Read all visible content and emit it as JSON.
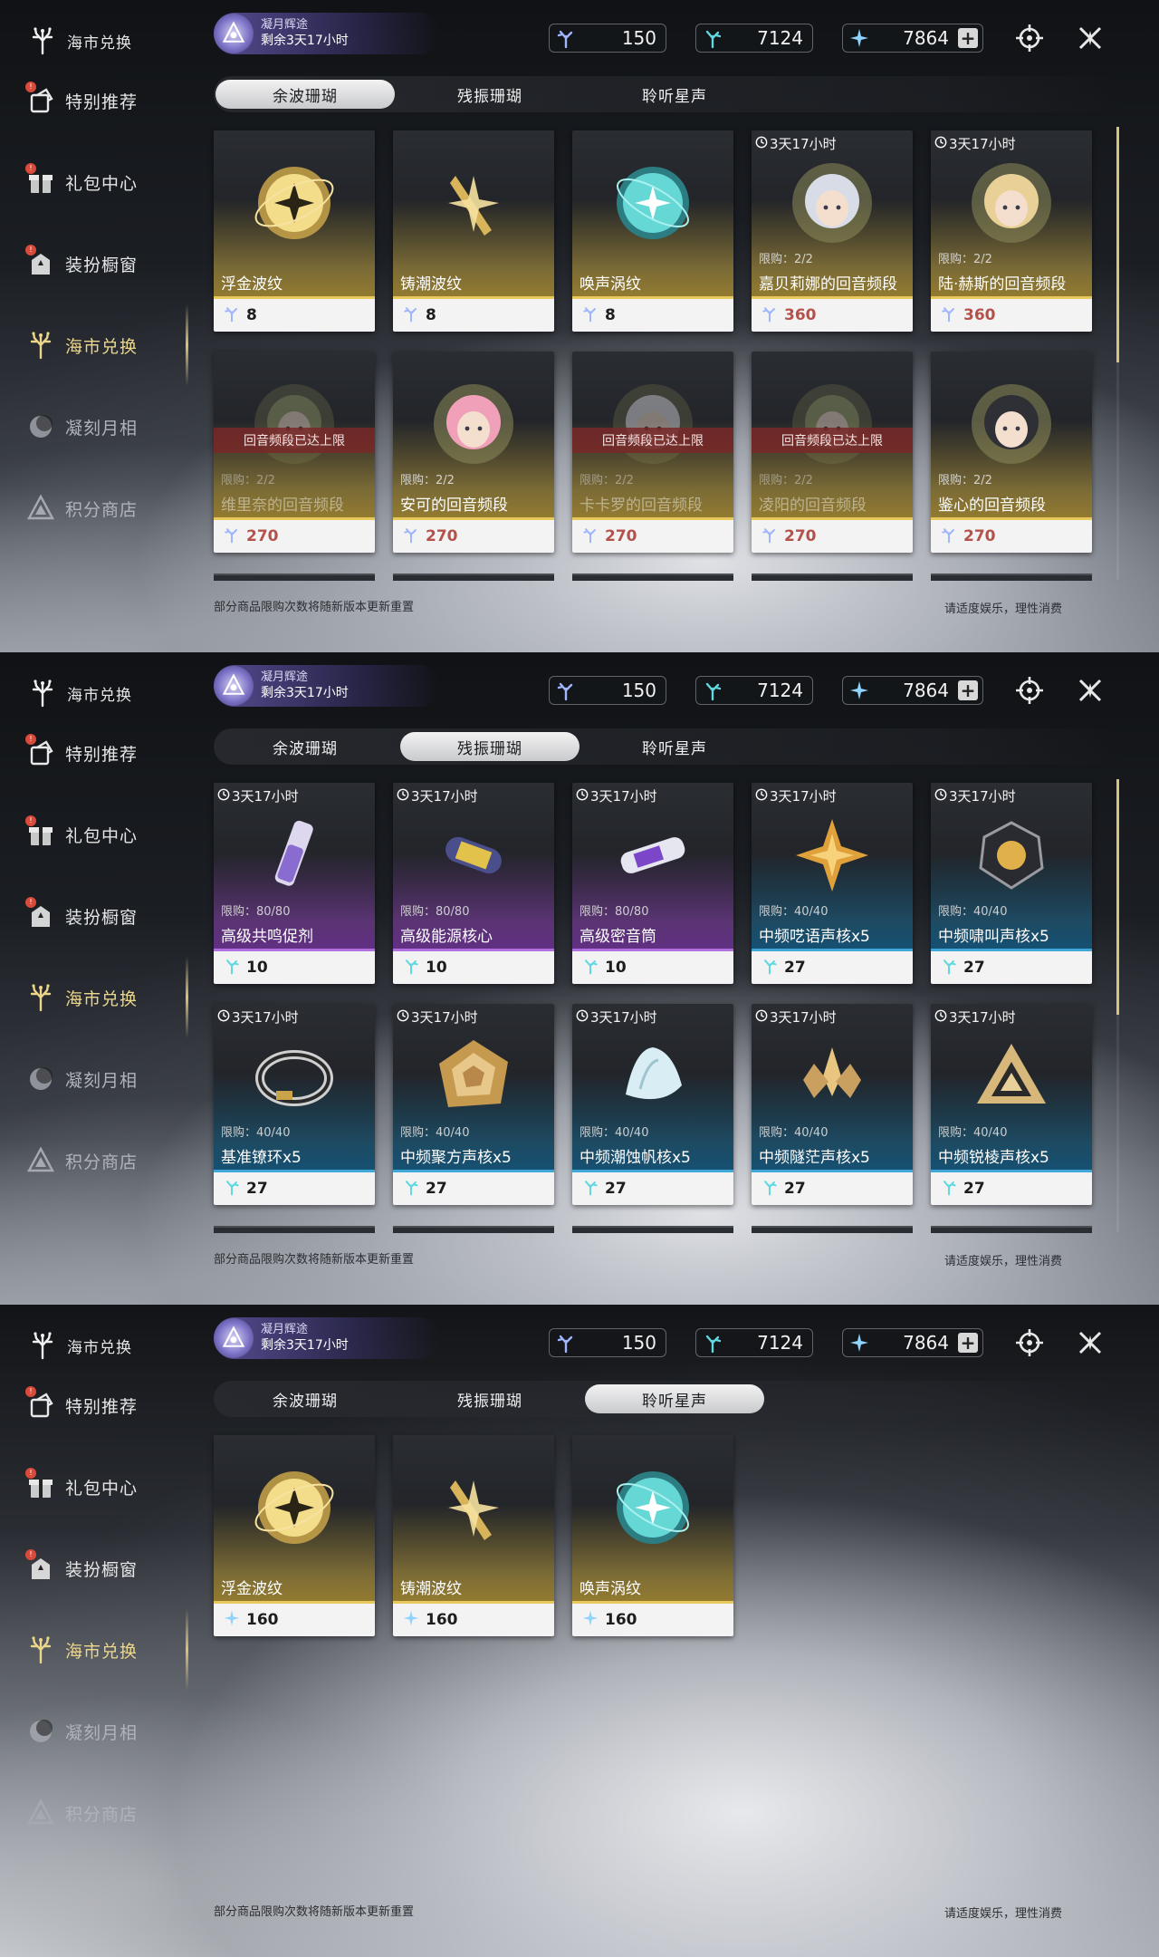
{
  "sidebar_header": "海市兑换",
  "sidebar": [
    {
      "label": "特别推荐",
      "icon": "recommend-icon",
      "badge": "!"
    },
    {
      "label": "礼包中心",
      "icon": "gift-icon",
      "badge": "!"
    },
    {
      "label": "装扮橱窗",
      "icon": "wardrobe-icon",
      "badge": "!"
    },
    {
      "label": "海市兑换",
      "icon": "coral-icon",
      "badge": ""
    },
    {
      "label": "凝刻月相",
      "icon": "moon-icon",
      "badge": ""
    },
    {
      "label": "积分商店",
      "icon": "points-shop-icon",
      "badge": ""
    }
  ],
  "event": {
    "title": "凝月辉途",
    "time": "剩余3天17小时"
  },
  "currencies": [
    {
      "icon": "afterglow-coral-icon",
      "value": "150"
    },
    {
      "icon": "oscillated-coral-icon",
      "value": "7124"
    },
    {
      "icon": "star-shard-icon",
      "value": "7864",
      "plus": "+"
    }
  ],
  "tabs": [
    "余波珊瑚",
    "残振珊瑚",
    "聆听星声"
  ],
  "footer": {
    "left": "部分商品限购次数将随新版本更新重置",
    "right": "请适度娱乐，理性消费"
  },
  "screens": [
    {
      "active_tab": 0,
      "cards": [
        {
          "tier": "gold",
          "timer": "",
          "limit": "",
          "name": "浮金波纹",
          "price": "8",
          "art": "gold-orb",
          "maxed": "",
          "warn": false
        },
        {
          "tier": "gold",
          "timer": "",
          "limit": "",
          "name": "铸潮波纹",
          "price": "8",
          "art": "gold-blade",
          "maxed": "",
          "warn": false
        },
        {
          "tier": "gold",
          "timer": "",
          "limit": "",
          "name": "唤声涡纹",
          "price": "8",
          "art": "teal-orb",
          "maxed": "",
          "warn": false
        },
        {
          "tier": "gold",
          "timer": "3天17小时",
          "limit": "限购：2/2",
          "name": "嘉贝莉娜的回音频段",
          "price": "360",
          "art": "portrait-silver",
          "maxed": "",
          "warn": true
        },
        {
          "tier": "gold",
          "timer": "3天17小时",
          "limit": "限购：2/2",
          "name": "陆·赫斯的回音频段",
          "price": "360",
          "art": "portrait-blond",
          "maxed": "",
          "warn": true
        },
        {
          "tier": "gold",
          "timer": "",
          "limit": "限购：2/2",
          "name": "维里奈的回音频段",
          "price": "270",
          "art": "portrait-green",
          "maxed": "回音频段已达上限",
          "warn": true
        },
        {
          "tier": "gold",
          "timer": "",
          "limit": "限购：2/2",
          "name": "安可的回音频段",
          "price": "270",
          "art": "portrait-pink",
          "maxed": "",
          "warn": true
        },
        {
          "tier": "gold",
          "timer": "",
          "limit": "限购：2/2",
          "name": "卡卡罗的回音频段",
          "price": "270",
          "art": "portrait-white",
          "maxed": "回音频段已达上限",
          "warn": true
        },
        {
          "tier": "gold",
          "timer": "",
          "limit": "限购：2/2",
          "name": "凌阳的回音频段",
          "price": "270",
          "art": "portrait-green",
          "maxed": "回音频段已达上限",
          "warn": true
        },
        {
          "tier": "gold",
          "timer": "",
          "limit": "限购：2/2",
          "name": "鉴心的回音频段",
          "price": "270",
          "art": "portrait-dark",
          "maxed": "",
          "warn": true
        }
      ]
    },
    {
      "active_tab": 1,
      "cards": [
        {
          "tier": "purple",
          "timer": "3天17小时",
          "limit": "限购：80/80",
          "name": "高级共鸣促剂",
          "price": "10",
          "art": "vial",
          "maxed": "",
          "warn": false
        },
        {
          "tier": "purple",
          "timer": "3天17小时",
          "limit": "限购：80/80",
          "name": "高级能源核心",
          "price": "10",
          "art": "capsule",
          "maxed": "",
          "warn": false
        },
        {
          "tier": "purple",
          "timer": "3天17小时",
          "limit": "限购：80/80",
          "name": "高级密音筒",
          "price": "10",
          "art": "cylinder",
          "maxed": "",
          "warn": false
        },
        {
          "tier": "blue",
          "timer": "3天17小时",
          "limit": "限购：40/40",
          "name": "中频呓语声核x5",
          "price": "27",
          "art": "star-core",
          "maxed": "",
          "warn": false
        },
        {
          "tier": "blue",
          "timer": "3天17小时",
          "limit": "限购：40/40",
          "name": "中频啸叫声核x5",
          "price": "27",
          "art": "dark-core",
          "maxed": "",
          "warn": false
        },
        {
          "tier": "blue",
          "timer": "3天17小时",
          "limit": "限购：40/40",
          "name": "基准镣环x5",
          "price": "27",
          "art": "ring",
          "maxed": "",
          "warn": false
        },
        {
          "tier": "blue",
          "timer": "3天17小时",
          "limit": "限购：40/40",
          "name": "中频聚方声核x5",
          "price": "27",
          "art": "layered-core",
          "maxed": "",
          "warn": false
        },
        {
          "tier": "blue",
          "timer": "3天17小时",
          "limit": "限购：40/40",
          "name": "中频潮蚀帆核x5",
          "price": "27",
          "art": "shell",
          "maxed": "",
          "warn": false
        },
        {
          "tier": "blue",
          "timer": "3天17小时",
          "limit": "限购：40/40",
          "name": "中频隧茫声核x5",
          "price": "27",
          "art": "crystal",
          "maxed": "",
          "warn": false
        },
        {
          "tier": "blue",
          "timer": "3天17小时",
          "limit": "限购：40/40",
          "name": "中频锐棱声核x5",
          "price": "27",
          "art": "triangle",
          "maxed": "",
          "warn": false
        }
      ]
    },
    {
      "active_tab": 2,
      "cards": [
        {
          "tier": "gold",
          "timer": "",
          "limit": "",
          "name": "浮金波纹",
          "price": "160",
          "art": "gold-orb",
          "maxed": "",
          "warn": false,
          "currency": "star"
        },
        {
          "tier": "gold",
          "timer": "",
          "limit": "",
          "name": "铸潮波纹",
          "price": "160",
          "art": "gold-blade",
          "maxed": "",
          "warn": false,
          "currency": "star"
        },
        {
          "tier": "gold",
          "timer": "",
          "limit": "",
          "name": "唤声涡纹",
          "price": "160",
          "art": "teal-orb",
          "maxed": "",
          "warn": false,
          "currency": "star"
        }
      ]
    }
  ],
  "colors": {
    "gold": "#e8c85a",
    "purple": "#b070e0",
    "blue": "#40a8d8",
    "active_nav": "#ecd68a",
    "warn_price": "#b5514a"
  }
}
